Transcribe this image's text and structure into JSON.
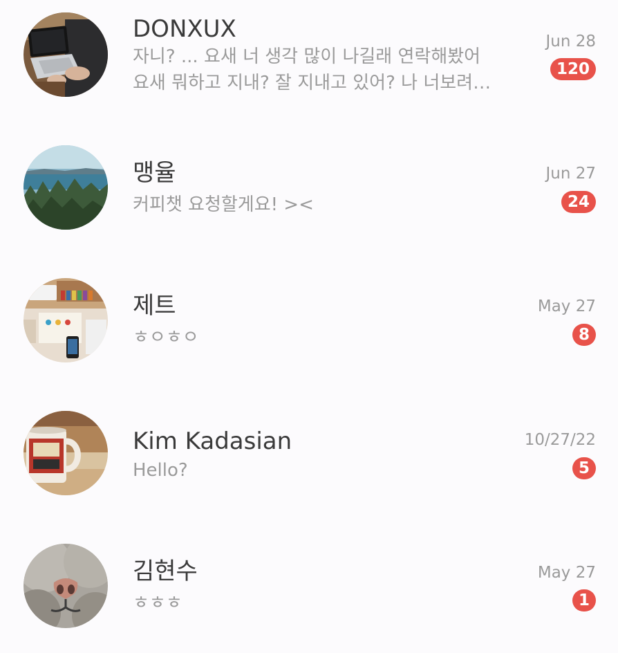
{
  "colors": {
    "badge": "#e8524a",
    "name_text": "#3a3a3a",
    "secondary_text": "#9a9a9a",
    "background": "#fcfbfd"
  },
  "chats": [
    {
      "name": "DONXUX",
      "preview_line1": "자니? ... 요새 너 생각 많이 나길래 연락해봤어",
      "preview_line2": "요새 뭐하고 지내? 잘 지내고 있어? 나 너보려…",
      "date": "Jun 28",
      "unread": "120",
      "avatar": "laptop-photo"
    },
    {
      "name": "맹율",
      "preview_line1": "커피챗 요청할게요! ><",
      "date": "Jun 27",
      "unread": "24",
      "avatar": "forest-sea-photo"
    },
    {
      "name": "제트",
      "preview_line1": "ㅎㅇㅎㅇ",
      "date": "May 27",
      "unread": "8",
      "avatar": "desk-photo"
    },
    {
      "name": "Kim Kadasian",
      "preview_line1": "Hello?",
      "date": "10/27/22",
      "unread": "5",
      "avatar": "coffee-mug-photo"
    },
    {
      "name": "김현수",
      "preview_line1": "ㅎㅎㅎ",
      "date": "May 27",
      "unread": "1",
      "avatar": "cat-nose-photo"
    }
  ]
}
